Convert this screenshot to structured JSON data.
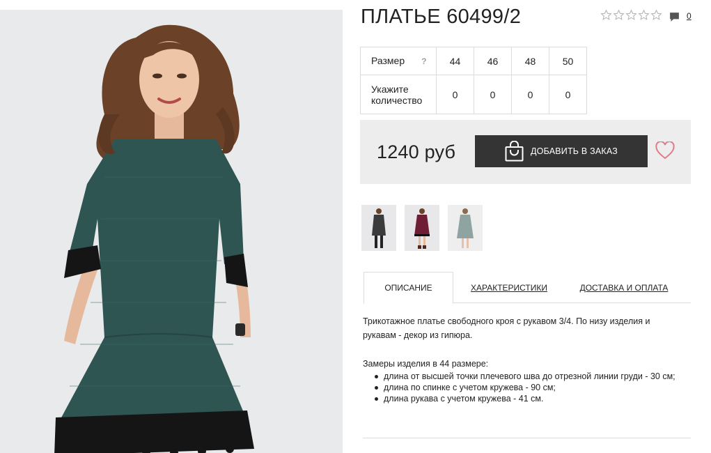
{
  "product": {
    "title": "ПЛАТЬЕ 60499/2",
    "rating_stars": 5,
    "rating_value": 0,
    "comments_count": "0"
  },
  "sizes": {
    "size_label": "Размер",
    "help_label": "?",
    "qty_label_line1": "Укажите",
    "qty_label_line2": "количество",
    "items": [
      {
        "size": "44",
        "qty": "0"
      },
      {
        "size": "46",
        "qty": "0"
      },
      {
        "size": "48",
        "qty": "0"
      },
      {
        "size": "50",
        "qty": "0"
      }
    ]
  },
  "purchase": {
    "price": "1240 руб",
    "add_button_label": "ДОБАВИТЬ В ЗАКАЗ"
  },
  "tabs": [
    {
      "label": "ОПИСАНИЕ",
      "active": true
    },
    {
      "label": "ХАРАКТЕРИСТИКИ",
      "active": false
    },
    {
      "label": "ДОСТАВКА И ОПЛАТА",
      "active": false
    }
  ],
  "description": {
    "text": "Трикотажное платье свободного кроя с рукавом 3/4. По низу изделия и рукавам - декор из гипюра.",
    "measures_title": "Замеры изделия в 44 размере:",
    "measures": [
      "длина от высшей точки плечевого шва до отрезной линии груди - 30 см;",
      "длина по спинке с учетом кружева - 90 см;",
      "длина рукава с учетом кружева - 41 см."
    ]
  },
  "colors": {
    "dress_green": "#2f5553",
    "dress_burgundy": "#6e1f35",
    "dress_grey": "#8fa3a0",
    "dress_dark": "#3b3b3b",
    "button_bg": "#343434",
    "heart": "#e07a8b",
    "panel_bg": "#ededed"
  },
  "icons": {
    "star": "star-outline-icon",
    "comment": "speech-bubble-icon",
    "bag": "shopping-bag-icon",
    "heart": "heart-outline-icon"
  }
}
